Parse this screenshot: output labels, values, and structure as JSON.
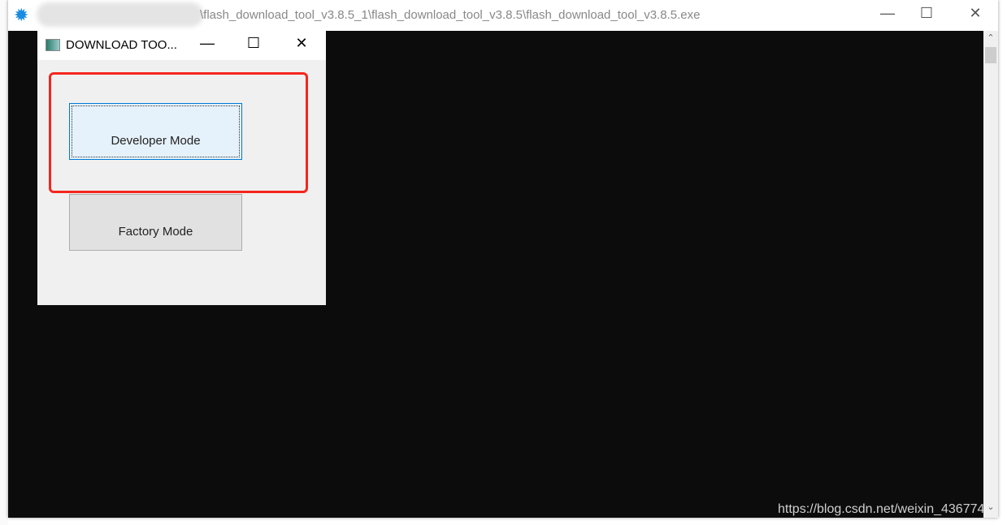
{
  "main_window": {
    "title": "\\flash_download_tool_v3.8.5_1\\flash_download_tool_v3.8.5\\flash_download_tool_v3.8.5.exe",
    "minimize": "—",
    "maximize": "☐",
    "close": "✕",
    "icon": "gear-icon"
  },
  "dialog": {
    "title": "DOWNLOAD TOO...",
    "minimize": "—",
    "maximize": "☐",
    "close": "✕",
    "developer_mode": "Developer Mode",
    "factory_mode": "Factory Mode"
  },
  "scrollbar": {
    "up": "⌃",
    "down": "⌄"
  },
  "watermark": "https://blog.csdn.net/weixin_436774",
  "colors": {
    "highlight": "#f5261e",
    "console_bg": "#0c0c0c",
    "selected_button": "#e5f1fb"
  }
}
